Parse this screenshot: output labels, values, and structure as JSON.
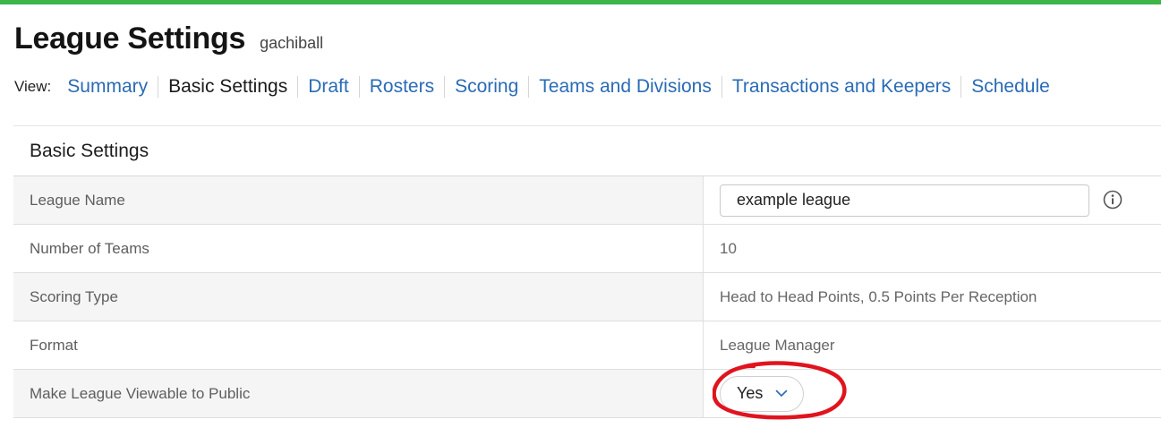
{
  "header": {
    "title": "League Settings",
    "league_name": "gachiball"
  },
  "nav": {
    "label": "View:",
    "tabs": [
      {
        "label": "Summary",
        "active": false
      },
      {
        "label": "Basic Settings",
        "active": true
      },
      {
        "label": "Draft",
        "active": false
      },
      {
        "label": "Rosters",
        "active": false
      },
      {
        "label": "Scoring",
        "active": false
      },
      {
        "label": "Teams and Divisions",
        "active": false
      },
      {
        "label": "Transactions and Keepers",
        "active": false
      },
      {
        "label": "Schedule",
        "active": false
      }
    ]
  },
  "panel": {
    "title": "Basic Settings",
    "rows": [
      {
        "label": "League Name",
        "value": "example league",
        "control": "text-input"
      },
      {
        "label": "Number of Teams",
        "value": "10",
        "control": "text"
      },
      {
        "label": "Scoring Type",
        "value": "Head to Head Points, 0.5 Points Per Reception",
        "control": "text"
      },
      {
        "label": "Format",
        "value": "League Manager",
        "control": "text"
      },
      {
        "label": "Make League Viewable to Public",
        "value": "Yes",
        "control": "select"
      }
    ]
  },
  "icons": {
    "info": "info-circle-icon",
    "dropdown": "chevron-down-icon"
  },
  "colors": {
    "top_bar": "#3db549",
    "link": "#2a6bb5",
    "annotation": "#e0141e"
  }
}
